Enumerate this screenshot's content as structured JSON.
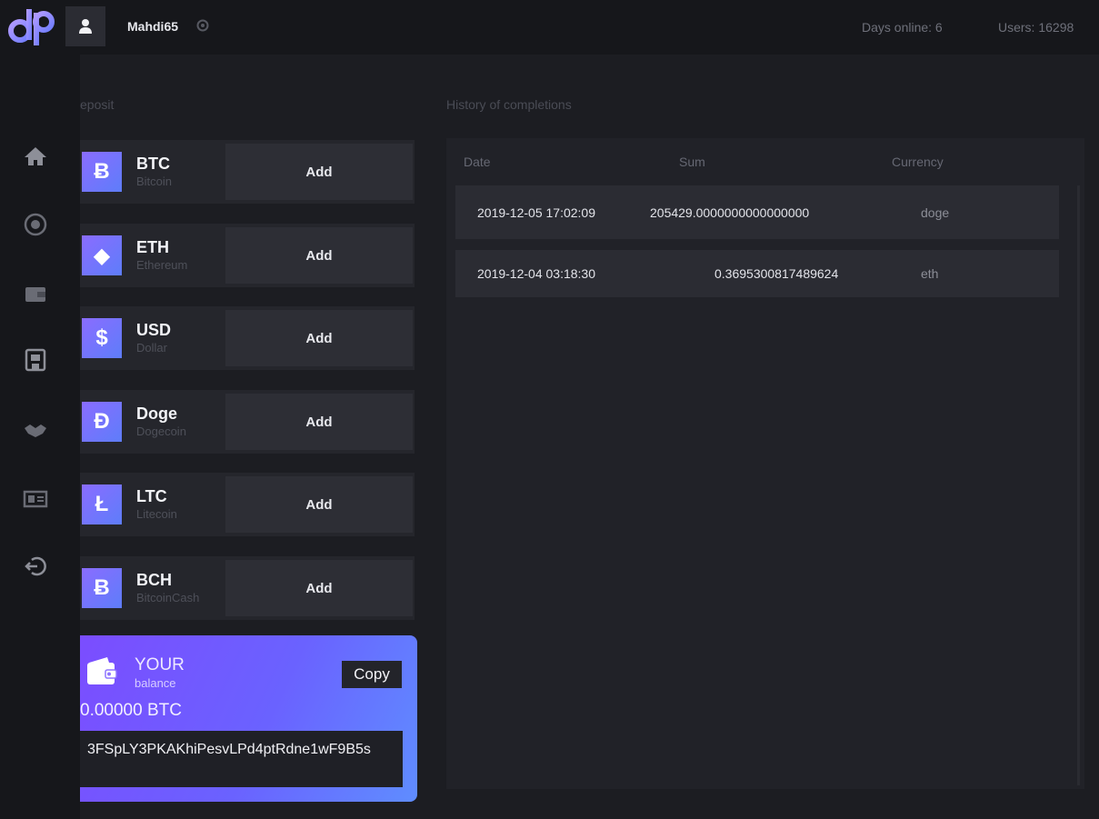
{
  "header": {
    "username": "Mahdi65",
    "days_online": "Days online: 6",
    "users": "Users: 16298"
  },
  "sidebar": {
    "items": [
      {
        "icon": "home-icon"
      },
      {
        "icon": "coin-icon"
      },
      {
        "icon": "wallet-icon"
      },
      {
        "icon": "atm-icon"
      },
      {
        "icon": "handshake-icon"
      },
      {
        "icon": "id-card-icon"
      },
      {
        "icon": "logout-icon"
      }
    ]
  },
  "deposit": {
    "label": "eposit",
    "currencies": [
      {
        "symbol": "Ƀ",
        "code": "BTC",
        "name": "Bitcoin",
        "add": "Add"
      },
      {
        "symbol": "◆",
        "code": "ETH",
        "name": "Ethereum",
        "add": "Add"
      },
      {
        "symbol": "$",
        "code": "USD",
        "name": "Dollar",
        "add": "Add"
      },
      {
        "symbol": "Đ",
        "code": "Doge",
        "name": "Dogecoin",
        "add": "Add"
      },
      {
        "symbol": "Ł",
        "code": "LTC",
        "name": "Litecoin",
        "add": "Add"
      },
      {
        "symbol": "Ƀ",
        "code": "BCH",
        "name": "BitcoinCash",
        "add": "Add"
      }
    ]
  },
  "balance": {
    "title": "YOUR",
    "subtitle": "balance",
    "copy": "Copy",
    "amount": "0.00000 BTC",
    "address": "3FSpLY3PKAKhiPesvLPd4ptRdne1wF9B5s"
  },
  "history": {
    "label": "History of completions",
    "columns": [
      "Date",
      "Sum",
      "Currency"
    ],
    "rows": [
      {
        "date": "2019-12-05 17:02:09",
        "sum": "205429.0000000000000000",
        "currency": "doge"
      },
      {
        "date": "2019-12-04 03:18:30",
        "sum": "0.36953008174896​24",
        "currency": "eth"
      }
    ]
  },
  "colors": {
    "accent": "#7b4dff",
    "background": "#1c1d22",
    "sidebar": "#16171b"
  }
}
